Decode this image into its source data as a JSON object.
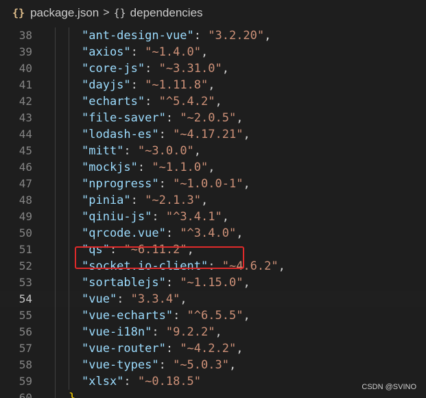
{
  "breadcrumb": {
    "file_icon": "{}",
    "file": "package.json",
    "separator": ">",
    "symbol_icon": "{}",
    "symbol": "dependencies"
  },
  "editor": {
    "current_line": 54,
    "highlighted_line": 50,
    "lines": [
      {
        "num": "38",
        "key": "\"ant-design-vue\"",
        "sep": ": ",
        "val": "\"3.2.20\"",
        "end": ","
      },
      {
        "num": "39",
        "key": "\"axios\"",
        "sep": ": ",
        "val": "\"~1.4.0\"",
        "end": ","
      },
      {
        "num": "40",
        "key": "\"core-js\"",
        "sep": ": ",
        "val": "\"~3.31.0\"",
        "end": ","
      },
      {
        "num": "41",
        "key": "\"dayjs\"",
        "sep": ": ",
        "val": "\"~1.11.8\"",
        "end": ","
      },
      {
        "num": "42",
        "key": "\"echarts\"",
        "sep": ": ",
        "val": "\"^5.4.2\"",
        "end": ","
      },
      {
        "num": "43",
        "key": "\"file-saver\"",
        "sep": ": ",
        "val": "\"~2.0.5\"",
        "end": ","
      },
      {
        "num": "44",
        "key": "\"lodash-es\"",
        "sep": ": ",
        "val": "\"~4.17.21\"",
        "end": ","
      },
      {
        "num": "45",
        "key": "\"mitt\"",
        "sep": ": ",
        "val": "\"~3.0.0\"",
        "end": ","
      },
      {
        "num": "46",
        "key": "\"mockjs\"",
        "sep": ": ",
        "val": "\"~1.1.0\"",
        "end": ","
      },
      {
        "num": "47",
        "key": "\"nprogress\"",
        "sep": ": ",
        "val": "\"~1.0.0-1\"",
        "end": ","
      },
      {
        "num": "48",
        "key": "\"pinia\"",
        "sep": ": ",
        "val": "\"~2.1.3\"",
        "end": ","
      },
      {
        "num": "49",
        "key": "\"qiniu-js\"",
        "sep": ": ",
        "val": "\"^3.4.1\"",
        "end": ","
      },
      {
        "num": "50",
        "key": "\"qrcode.vue\"",
        "sep": ": ",
        "val": "\"^3.4.0\"",
        "end": ","
      },
      {
        "num": "51",
        "key": "\"qs\"",
        "sep": ": ",
        "val": "\"~6.11.2\"",
        "end": ","
      },
      {
        "num": "52",
        "key": "\"socket.io-client\"",
        "sep": ": ",
        "val": "\"~4.6.2\"",
        "end": ","
      },
      {
        "num": "53",
        "key": "\"sortablejs\"",
        "sep": ": ",
        "val": "\"~1.15.0\"",
        "end": ","
      },
      {
        "num": "54",
        "key": "\"vue\"",
        "sep": ": ",
        "val": "\"3.3.4\"",
        "end": ","
      },
      {
        "num": "55",
        "key": "\"vue-echarts\"",
        "sep": ": ",
        "val": "\"^6.5.5\"",
        "end": ","
      },
      {
        "num": "56",
        "key": "\"vue-i18n\"",
        "sep": ": ",
        "val": "\"9.2.2\"",
        "end": ","
      },
      {
        "num": "57",
        "key": "\"vue-router\"",
        "sep": ": ",
        "val": "\"~4.2.2\"",
        "end": ","
      },
      {
        "num": "58",
        "key": "\"vue-types\"",
        "sep": ": ",
        "val": "\"~5.0.3\"",
        "end": ","
      },
      {
        "num": "59",
        "key": "\"xlsx\"",
        "sep": ": ",
        "val": "\"~0.18.5\"",
        "end": ""
      },
      {
        "num": "60",
        "brace": "},"
      }
    ]
  },
  "watermark": "CSDN @SVINO"
}
